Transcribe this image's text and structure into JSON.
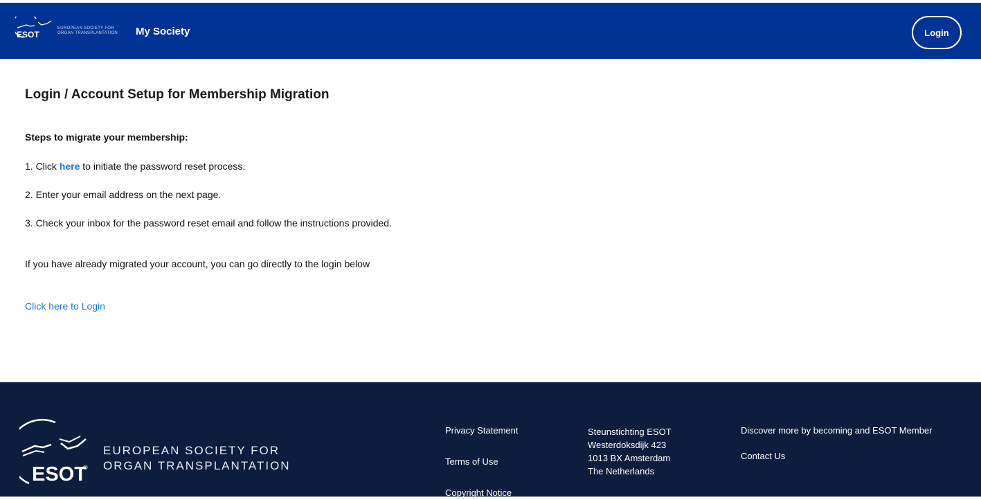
{
  "header": {
    "logo_mark": "ESOT",
    "logo_text_line1": "EUROPEAN SOCIETY FOR",
    "logo_text_line2": "ORGAN TRANSPLANTATION",
    "title": "My Society",
    "login_label": "Login"
  },
  "main": {
    "page_title": "Login / Account Setup for Membership Migration",
    "steps_heading": "Steps to migrate your membership:",
    "step1_prefix": "1. Click ",
    "step1_link": "here",
    "step1_suffix": " to initiate the password reset process.",
    "step2": "2. Enter your email address on the next page.",
    "step3": "3. Check your inbox for the password reset email and follow the instructions provided.",
    "note": "If you have already migrated your account, you can go directly to the login below",
    "login_link": "Click here to Login"
  },
  "footer": {
    "logo_mark": "ESOT",
    "org_line1": "EUROPEAN SOCIETY FOR",
    "org_line2": "ORGAN TRANSPLANTATION",
    "links_col1": [
      "Privacy Statement",
      "Terms of Use",
      "Copyright Notice"
    ],
    "address": [
      "Steunstichting ESOT",
      "Westerdoksdijk 423",
      "1013 BX Amsterdam",
      "The Netherlands"
    ],
    "discover": "Discover  more by becoming and ESOT Member",
    "contact": "Contact Us"
  },
  "colors": {
    "header_bg": "#003393",
    "footer_bg": "#0c1d3e",
    "link": "#1a73e8"
  },
  "icons": [
    "esot-logo-icon",
    "hands-icon"
  ]
}
